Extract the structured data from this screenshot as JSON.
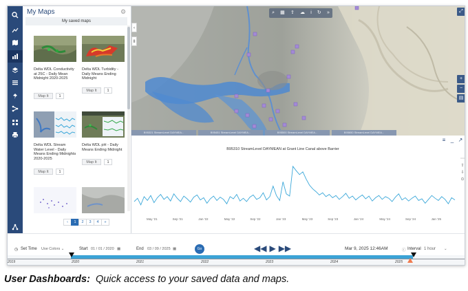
{
  "app": {
    "panel_title": "My Maps",
    "saved_label": "My saved maps"
  },
  "cards": [
    {
      "title": "Delta WDL Conductivity at 25C - Daily Mean Midnight 2020-2025",
      "mapit": "Map It",
      "count": "1"
    },
    {
      "title": "Delta WDL Turbidity - Daily Means Ending Midnight",
      "mapit": "Map It",
      "count": "1"
    },
    {
      "title": "Delta WDL Stream Water Level - Daily Means Ending Midnights 2020-2025",
      "mapit": "Map It",
      "count": "1"
    },
    {
      "title": "Delta WDL pH - Daily Means Ending Midnight",
      "mapit": "Map It",
      "count": "1"
    },
    {
      "title": "",
      "mapit": "",
      "count": ""
    },
    {
      "title": "",
      "mapit": "",
      "count": ""
    }
  ],
  "pager": {
    "prev": "‹",
    "pages": [
      "1",
      "2",
      "3",
      "4"
    ],
    "next": "»"
  },
  "station_tabs": [
    "B95321 StreamLevel DAYMEA...",
    "B95451 StreamLevel DAYMEA...",
    "B95500 StreamLevel DAYMEA...",
    "B95650 StreamLevel DAYMEA..."
  ],
  "chart_data": {
    "type": "line",
    "title": "B95310 StreamLevel DAYMEAN at Grant Line Canal above Barrier",
    "x_ticks": [
      "May '21",
      "Sep '21",
      "Jan '22",
      "May '22",
      "Sep '22",
      "Jan '23",
      "May '23",
      "Sep '23",
      "Jan '24",
      "May '24",
      "Sep '24",
      "Jan '25"
    ],
    "series": [
      {
        "values": [
          2.0,
          2.6,
          1.4,
          2.9,
          2.2,
          3.1,
          1.8,
          2.7,
          3.3,
          2.4,
          2.9,
          2.1,
          3.4,
          2.6,
          2.0,
          3.0,
          2.5,
          1.9,
          2.8,
          3.2,
          2.3,
          2.7,
          1.7,
          2.5,
          3.0,
          2.2,
          2.8,
          2.4,
          1.6,
          2.9,
          2.5,
          3.3,
          2.1,
          2.6,
          2.0,
          2.8,
          3.2,
          2.4,
          2.7,
          3.6,
          2.3,
          2.9,
          4.8,
          3.1,
          2.2,
          5.6,
          3.4,
          3.0,
          8.4,
          7.6,
          6.9,
          7.4,
          6.1,
          5.0,
          4.3,
          3.8,
          3.2,
          3.6,
          2.9,
          3.3,
          2.7,
          3.1,
          2.4,
          2.9,
          3.5,
          2.6,
          3.0,
          2.3,
          2.8,
          3.2,
          2.5,
          3.0,
          2.1,
          2.7,
          3.1,
          2.4,
          2.9,
          2.6,
          2.0,
          2.8,
          3.4,
          2.3,
          2.7,
          2.1,
          2.6,
          3.0,
          2.2,
          2.5,
          1.7,
          2.4,
          3.1,
          2.6,
          2.2,
          2.9,
          2.4,
          1.6,
          2.7,
          2.3
        ]
      }
    ],
    "ylim": [
      0,
      10
    ]
  },
  "time": {
    "set_time_label": "Set Time",
    "use_colors_label": "Use Colors ⌄",
    "start_label": "Start",
    "start_value": "01 / 01 / 2020",
    "end_label": "End",
    "end_value": "03 / 09 / 2025",
    "go_label": "Go",
    "current_datetime": "Mar 9, 2025 12:46AM",
    "interval_label": "Interval",
    "interval_value": "1 hour"
  },
  "timeline_ticks": [
    "2019",
    "2020",
    "2021",
    "2022",
    "2023",
    "2024",
    "2025"
  ],
  "caption": {
    "bold": "User Dashboards:",
    "rest": "Quick access to your saved data and maps."
  },
  "colors": {
    "rail": "#2a4a7a",
    "accent": "#2a6cb3",
    "timeline": "#3ba3d6",
    "line_series": "#3aa7d9"
  }
}
